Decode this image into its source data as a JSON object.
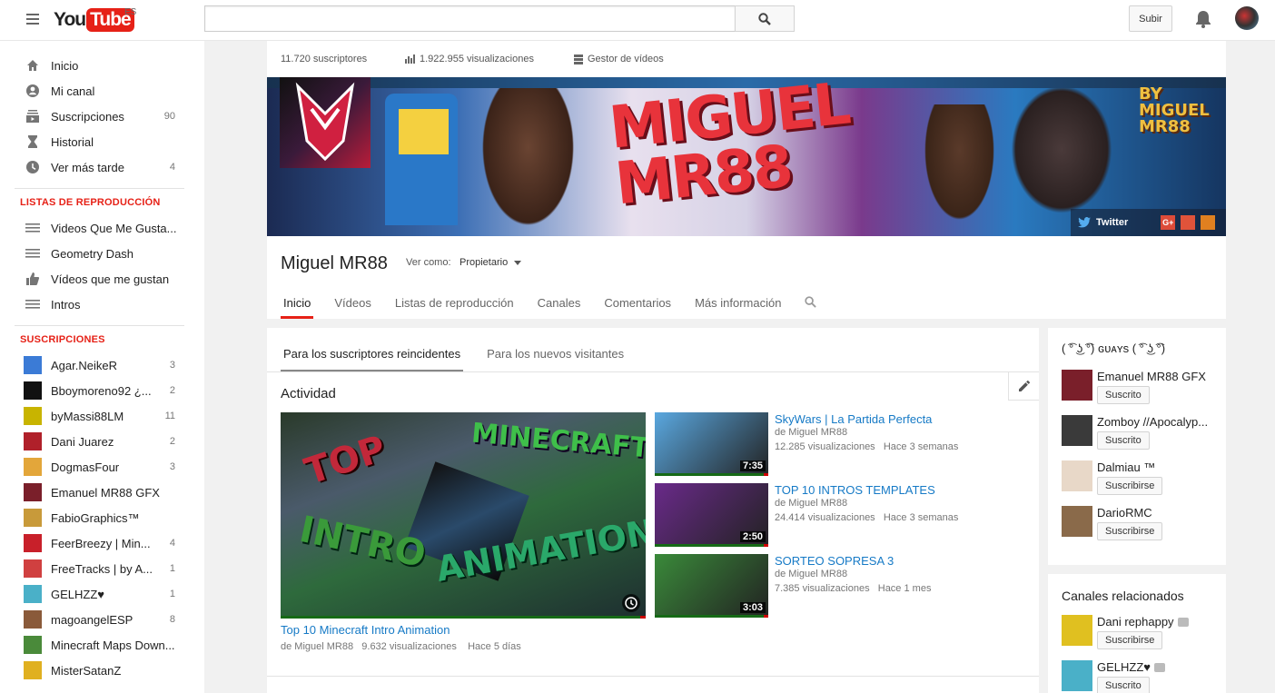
{
  "header": {
    "logo_you": "You",
    "logo_tube": "Tube",
    "locale": "ES",
    "search_placeholder": "",
    "upload_label": "Subir",
    "icons": [
      "menu-icon",
      "search-icon",
      "bell-icon",
      "avatar"
    ]
  },
  "sidebar": {
    "main": [
      {
        "label": "Inicio",
        "icon": "home-icon",
        "count": ""
      },
      {
        "label": "Mi canal",
        "icon": "account-icon",
        "count": ""
      },
      {
        "label": "Suscripciones",
        "icon": "subscriptions-icon",
        "count": "90"
      },
      {
        "label": "Historial",
        "icon": "history-icon",
        "count": ""
      },
      {
        "label": "Ver más tarde",
        "icon": "clock-icon",
        "count": "4"
      }
    ],
    "playlists_heading": "LISTAS DE REPRODUCCIÓN",
    "playlists": [
      {
        "label": "Videos Que Me Gusta...",
        "icon": "list-icon"
      },
      {
        "label": "Geometry Dash",
        "icon": "list-icon"
      },
      {
        "label": "Vídeos que me gustan",
        "icon": "thumbs-up-icon"
      },
      {
        "label": "Intros",
        "icon": "list-icon"
      }
    ],
    "subs_heading": "SUSCRIPCIONES",
    "subscriptions": [
      {
        "label": "Agar.NeikeR",
        "count": "3",
        "color": "#3b7bd6"
      },
      {
        "label": "Bboymoreno92 ¿...",
        "count": "2",
        "color": "#111111"
      },
      {
        "label": "byMassi88LM",
        "count": "11",
        "color": "#c8b400"
      },
      {
        "label": "Dani Juarez",
        "count": "2",
        "color": "#b0202a"
      },
      {
        "label": "DogmasFour",
        "count": "3",
        "color": "#e3a63a"
      },
      {
        "label": "Emanuel MR88 GFX",
        "count": "",
        "color": "#7a1f2a"
      },
      {
        "label": "FabioGraphics™",
        "count": "",
        "color": "#c89a3a"
      },
      {
        "label": "FeerBreezy | Min...",
        "count": "4",
        "color": "#c8202a"
      },
      {
        "label": "FreeTracks | by A...",
        "count": "1",
        "color": "#d04040"
      },
      {
        "label": "GELHZZ♥",
        "count": "1",
        "color": "#4ab0c8"
      },
      {
        "label": "magoangelESP",
        "count": "8",
        "color": "#8a5a3a"
      },
      {
        "label": "Minecraft Maps Down...",
        "count": "",
        "color": "#4a8a3a"
      },
      {
        "label": "MisterSatanZ",
        "count": "",
        "color": "#e0b020"
      }
    ]
  },
  "channel": {
    "subscribers": "11.720 suscriptores",
    "views": "1.922.955 visualizaciones",
    "video_manager": "Gestor de vídeos",
    "banner_title_line1": "MIGUEL",
    "banner_title_line2": "MR88",
    "banner_by": "BY MIGUEL MR88",
    "banner_twitter": "Twitter",
    "name": "Miguel MR88",
    "view_as_label": "Ver como:",
    "view_as_value": "Propietario",
    "tabs": [
      "Inicio",
      "Vídeos",
      "Listas de reproducción",
      "Canales",
      "Comentarios",
      "Más información"
    ]
  },
  "content": {
    "subtabs": [
      "Para los suscriptores reincidentes",
      "Para los nuevos visitantes"
    ],
    "activity_title": "Actividad",
    "featured": {
      "title": "Top 10 Minecraft Intro Animation",
      "by": "de Miguel MR88",
      "views": "9.632 visualizaciones",
      "age": "Hace 5 días",
      "thumb_text": [
        "TOP",
        "MINECRAFT",
        "INTRO",
        "ANIMATION"
      ]
    },
    "videos": [
      {
        "title": "SkyWars | La Partida Perfecta",
        "by": "de Miguel MR88",
        "views": "12.285 visualizaciones",
        "age": "Hace 3 semanas",
        "duration": "7:35",
        "color": "#5aa8e0"
      },
      {
        "title": "TOP 10 INTROS TEMPLATES",
        "by": "de Miguel MR88",
        "views": "24.414 visualizaciones",
        "age": "Hace 3 semanas",
        "duration": "2:50",
        "color": "#6a2a8a"
      },
      {
        "title": "SORTEO SOPRESA 3",
        "by": "de Miguel MR88",
        "views": "7.385 visualizaciones",
        "age": "Hace 1 mes",
        "duration": "3:03",
        "color": "#3a8a3a"
      }
    ]
  },
  "right": {
    "featured_title": "( ͡° ͜ʖ ͡°) ɢᴜᴀʏs ( ͡° ͜ʖ ͡°)",
    "featured_channels": [
      {
        "name": "Emanuel MR88 GFX",
        "button": "Suscrito",
        "color": "#7a1f2a"
      },
      {
        "name": "Zomboy //Apocalyp...",
        "button": "Suscrito",
        "color": "#3a3a3a"
      },
      {
        "name": "Dalmiau ™",
        "button": "Suscribirse",
        "color": "#e8d8c8"
      },
      {
        "name": "DarioRMC",
        "button": "Suscribirse",
        "color": "#8a6a4a"
      }
    ],
    "related_title": "Canales relacionados",
    "related_channels": [
      {
        "name": "Dani rephappy",
        "button": "Suscribirse",
        "color": "#e0c020"
      },
      {
        "name": "GELHZZ♥",
        "button": "Suscrito",
        "color": "#4ab0c8"
      }
    ]
  }
}
